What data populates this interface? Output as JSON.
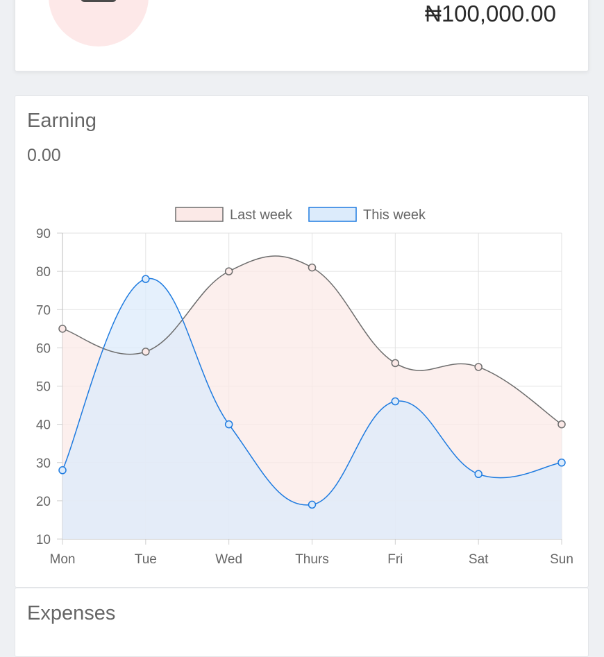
{
  "balance": {
    "amount": "₦100,000.00"
  },
  "earning": {
    "title": "Earning",
    "amount": "0.00"
  },
  "expenses": {
    "title": "Expenses"
  },
  "chart_data": {
    "type": "line",
    "categories": [
      "Mon",
      "Tue",
      "Wed",
      "Thurs",
      "Fri",
      "Sat",
      "Sun"
    ],
    "ylim": [
      10,
      90
    ],
    "yticks": [
      10,
      20,
      30,
      40,
      50,
      60,
      70,
      80,
      90
    ],
    "grid": true,
    "legend_position": "top",
    "series": [
      {
        "name": "Last week",
        "values": [
          65,
          59,
          80,
          81,
          56,
          55,
          40
        ],
        "stroke": "#6d6d6d",
        "fill": "#fbe9e7"
      },
      {
        "name": "This week",
        "values": [
          28,
          78,
          40,
          19,
          46,
          27,
          30
        ],
        "stroke": "#1e7be0",
        "fill": "#dcebfb"
      }
    ]
  }
}
